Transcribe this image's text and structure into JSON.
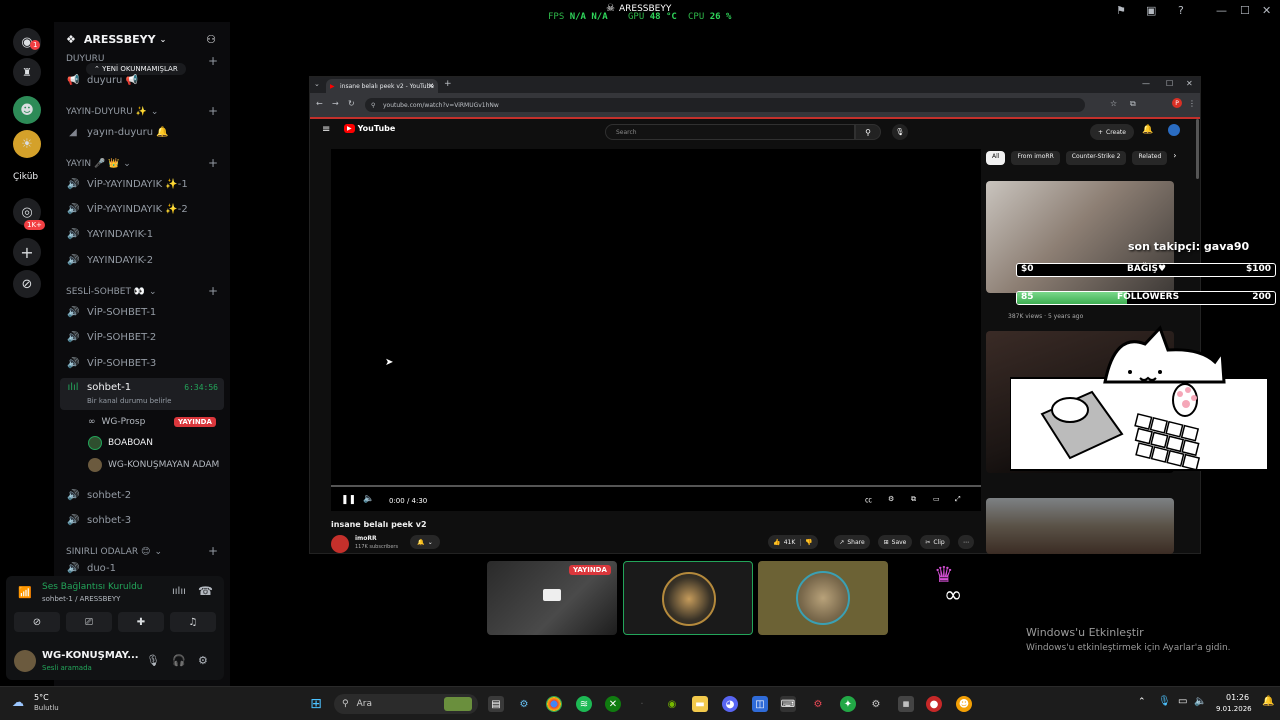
{
  "osd": {
    "fps_label": "FPS",
    "fps_value": "N/A",
    "fps_value2": "N/A",
    "gpu_label": "GPU",
    "gpu_value": "48 °C",
    "cpu_label": "CPU",
    "cpu_value": "26 %",
    "user_name": "ARESSBEYY"
  },
  "rail": {
    "badge_home": "1",
    "cikub_label": "Çiküb",
    "badge_1k": "1K+"
  },
  "guild": {
    "name": "ARESSBEYY",
    "unread_pill": "YENİ OKUNMAMIŞLAR",
    "categories": {
      "duyuru": "DUYURU",
      "yayin_duyuru": "YAYIN-DUYURU ✨",
      "yayin": "YAYIN 🎤 👑",
      "sesli_sohbet": "SESLİ-SOHBET 👀",
      "sinirli_odalar": "SINIRLI ODALAR 😊"
    },
    "channels": {
      "duyuru": "duyuru 📢",
      "yayin_duyuru": "yayın-duyuru 🔔",
      "vip_yayin_1": "VİP-YAYINDAYIK ✨-1",
      "vip_yayin_2": "VİP-YAYINDAYIK ✨-2",
      "yayindayik_1": "YAYINDAYIK-1",
      "yayindayik_2": "YAYINDAYIK-2",
      "vip_sohbet_1": "VİP-SOHBET-1",
      "vip_sohbet_2": "VİP-SOHBET-2",
      "vip_sohbet_3": "VİP-SOHBET-3",
      "sohbet_1": "sohbet-1",
      "sohbet_1_timer": "6:34:56",
      "sohbet_1_status": "Bir kanal durumu belirle",
      "sohbet_2": "sohbet-2",
      "sohbet_3": "sohbet-3",
      "duo_1": "duo-1"
    },
    "voice_users": [
      {
        "name": "WG-Prosp",
        "badge": "YAYINDA"
      },
      {
        "name": "BOABOAN"
      },
      {
        "name": "WG-KONUŞMAYAN ADAM"
      }
    ]
  },
  "voice_panel": {
    "status": "Ses Bağlantısı Kuruldu",
    "channel": "sohbet-1 / ARESSBEYY",
    "user": "WG-KONUŞMAY...",
    "user_status": "Sesli aramada"
  },
  "browser": {
    "tab_title": "insane belalı peek v2 - YouTube",
    "url": "youtube.com/watch?v=ViRMUGv1hNw",
    "search_placeholder": "Search",
    "create_label": "Create",
    "logo_text": "YouTube",
    "chips": [
      "All",
      "From imoRR",
      "Counter-Strike 2",
      "Related"
    ],
    "time": "0:00 / 4:30",
    "video_title": "insane belalı peek v2",
    "channel_name": "imoRR",
    "subscribers": "117K subscribers",
    "likes": "41K",
    "share_label": "Share",
    "save_label": "Save",
    "clip_label": "Clip",
    "rec_meta": "387K views · 5 years ago"
  },
  "overlay": {
    "last_follower": "son takipçi: gava90",
    "donation_min": "$0",
    "donation_label": "BAĞIŞ♥",
    "donation_max": "$100",
    "followers_cur": "85",
    "followers_label": "FOLLOWERS",
    "followers_max": "200"
  },
  "streams": {
    "live_badge": "YAYINDA"
  },
  "activation": {
    "title": "Windows'u Etkinleştir",
    "subtitle": "Windows'u etkinleştirmek için Ayarlar'a gidin."
  },
  "taskbar": {
    "weather_temp": "5°C",
    "weather_desc": "Bulutlu",
    "search_placeholder": "Ara",
    "time": "01:26",
    "date": "9.01.2026"
  }
}
